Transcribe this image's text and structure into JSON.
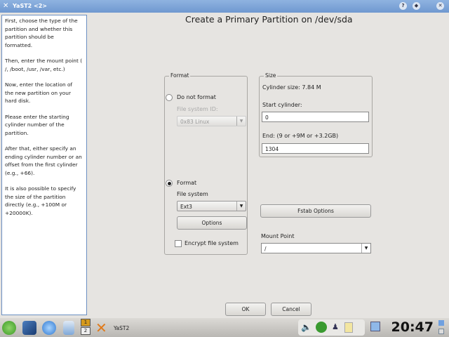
{
  "window": {
    "title": "YaST2 <2>",
    "buttons": [
      "?",
      "◆",
      "✕"
    ]
  },
  "help": {
    "paragraphs": [
      [
        "First, choose the type of the",
        "partition and whether this",
        "partition should be",
        "formatted."
      ],
      [
        "Then, enter the mount point (",
        "/, /boot, /usr, /var, etc.)"
      ],
      [
        "Now, enter the location of",
        "the new partition on your",
        "hard disk."
      ],
      [
        "Please enter the starting",
        "cylinder number of the",
        "partition."
      ],
      [
        "After that, either specify an",
        "ending cylinder number or an",
        "offset from the first cylinder",
        "(e.g., +66)."
      ],
      [
        "It is also possible to specify",
        "the size of the partition",
        "directly (e.g., +100M or",
        "+20000K)."
      ]
    ]
  },
  "dialog": {
    "title": "Create a Primary Partition on /dev/sda"
  },
  "format": {
    "label": "Format",
    "do_not_format": "Do not format",
    "fs_id_label": "File system ID:",
    "fs_id_value": "0x83 Linux",
    "format_label": "Format",
    "selected": "Format",
    "fs_label": "File system",
    "fs_value": "Ext3",
    "options": "Options",
    "encrypt": "Encrypt file system",
    "encrypt_checked": false
  },
  "size": {
    "label": "Size",
    "cyl_size": "Cylinder size: 7.84 M",
    "start_label": "Start cylinder:",
    "start_value": "0",
    "end_label": "End:  (9 or +9M or +3.2GB)",
    "end_value": "1304"
  },
  "fstab": "Fstab Options",
  "mount": {
    "label": "Mount Point",
    "value": "/"
  },
  "ok": "OK",
  "cancel": "Cancel",
  "taskbar": {
    "desktops": [
      "1",
      "2"
    ],
    "task": "YaST2",
    "clock": "20:47"
  }
}
